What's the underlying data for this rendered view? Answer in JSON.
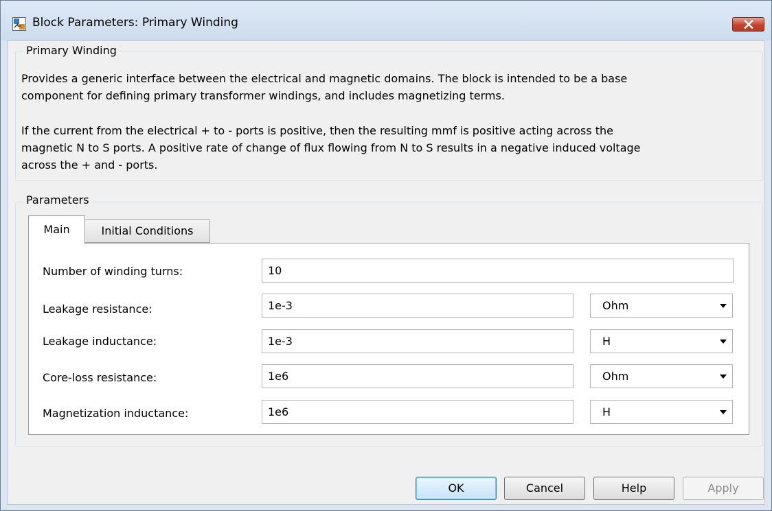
{
  "window": {
    "title": "Block Parameters: Primary Winding",
    "close_icon": "close-icon"
  },
  "description": {
    "group_title": "Primary Winding",
    "paragraph1_lines": [
      "Provides a generic interface between the electrical and magnetic domains. The block is intended to be a base",
      "component for defining primary transformer windings, and includes magnetizing terms."
    ],
    "paragraph2_lines": [
      "If the current from the electrical + to - ports is positive, then the resulting mmf is positive acting across the",
      "magnetic N to S ports. A positive rate of change of flux flowing from N to S results in a negative induced voltage",
      "across the + and - ports."
    ]
  },
  "parameters": {
    "group_title": "Parameters",
    "tabs": [
      {
        "label": "Main",
        "active": true
      },
      {
        "label": "Initial Conditions",
        "active": false
      }
    ],
    "rows": [
      {
        "label": "Number of winding turns:",
        "value": "10"
      },
      {
        "label": "Leakage resistance:",
        "value": "1e-3",
        "unit": "Ohm"
      },
      {
        "label": "Leakage inductance:",
        "value": "1e-3",
        "unit": "H"
      },
      {
        "label": "Core-loss resistance:",
        "value": "1e6",
        "unit": "Ohm"
      },
      {
        "label": "Magnetization inductance:",
        "value": "1e6",
        "unit": "H"
      }
    ]
  },
  "buttons": {
    "ok": "OK",
    "cancel": "Cancel",
    "help": "Help",
    "apply": "Apply"
  },
  "colors": {
    "title_bar": "#cddcee",
    "close_button": "#c4422c",
    "ok_button_border": "#3c7fb1",
    "dialog_background": "#f0f0f0"
  }
}
